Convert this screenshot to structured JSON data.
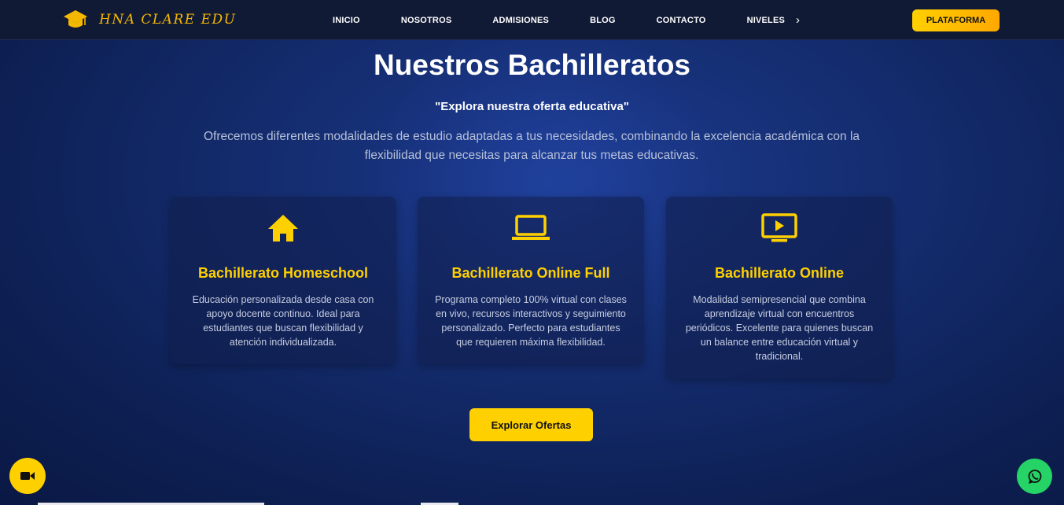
{
  "brand": {
    "name": "HNA CLARE EDU",
    "color": "#f5b800"
  },
  "nav": {
    "items": [
      {
        "label": "INICIO"
      },
      {
        "label": "NOSOTROS"
      },
      {
        "label": "ADMISIONES"
      },
      {
        "label": "BLOG"
      },
      {
        "label": "CONTACTO"
      },
      {
        "label": "NIVELES"
      }
    ],
    "cta_label": "PLATAFORMA"
  },
  "hero": {
    "title": "Nuestros Bachilleratos",
    "subtitle": "\"Explora nuestra oferta educativa\"",
    "description": "Ofrecemos diferentes modalidades de estudio adaptadas a tus necesidades, combinando la excelencia académica con la flexibilidad que necesitas para alcanzar tus metas educativas."
  },
  "cards": [
    {
      "icon": "home-icon",
      "title": "Bachillerato Homeschool",
      "text": "Educación personalizada desde casa con apoyo docente continuo. Ideal para estudiantes que buscan flexibilidad y atención individualizada."
    },
    {
      "icon": "laptop-icon",
      "title": "Bachillerato Online Full",
      "text": "Programa completo 100% virtual con clases en vivo, recursos interactivos y seguimiento personalizado. Perfecto para estudiantes que requieren máxima flexibilidad."
    },
    {
      "icon": "video-play-icon",
      "title": "Bachillerato Online",
      "text": "Modalidad semipresencial que combina aprendizaje virtual con encuentros periódicos. Excelente para quienes buscan un balance entre educación virtual y tradicional."
    }
  ],
  "cta": {
    "label": "Explorar Ofertas"
  },
  "floating": {
    "left_icon": "video-camera-icon",
    "right_icon": "whatsapp-icon"
  },
  "colors": {
    "accent": "#ffd000",
    "background": "#142c6e",
    "navbar": "#111a35",
    "whatsapp": "#25d366"
  }
}
